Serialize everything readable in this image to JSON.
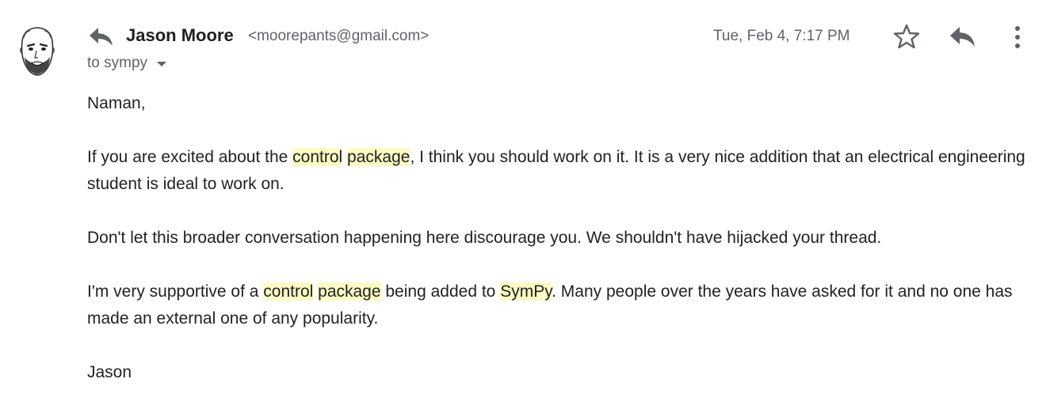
{
  "header": {
    "sender_name": "Jason Moore",
    "sender_email": "<moorepants@gmail.com>",
    "recipient": "to sympy",
    "timestamp": "Tue, Feb 4, 7:17 PM"
  },
  "icons": {
    "avatar": "avatar-sketch",
    "reply_indicator": "reply-icon",
    "recipient_toggle": "chevron-down-icon",
    "star": "star-icon",
    "reply": "reply-icon",
    "more": "more-vert-icon"
  },
  "colors": {
    "highlight": "#fbfbc4",
    "secondary_text": "#5f6368",
    "body_text": "#222222"
  },
  "message": {
    "greeting": "Naman,",
    "p1": {
      "t1": "If you are excited about the ",
      "h1": "control",
      "t2": " ",
      "h2": "package",
      "t3": ", I think you should work on it. It is a very nice addition that an electrical engineering student is ideal to work on."
    },
    "p2": "Don't let this broader conversation happening here discourage you. We shouldn't have hijacked your thread.",
    "p3": {
      "t1": "I'm very supportive of a ",
      "h1": "control",
      "t2": " ",
      "h2": "package",
      "t3": " being added to ",
      "h3": "SymPy",
      "t4": ". Many people over the years have asked for it and no one has made an external one of any popularity."
    },
    "signature": "Jason"
  }
}
